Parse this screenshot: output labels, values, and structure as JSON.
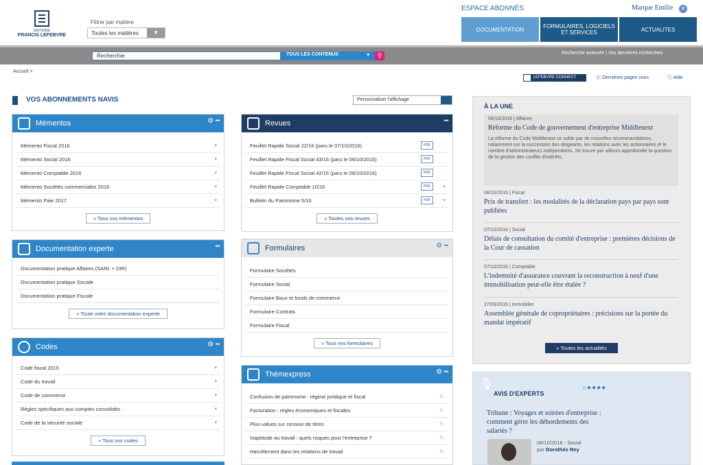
{
  "header": {
    "logo_line1": "EDITIONS",
    "logo_line2": "FRANCIS LEFEBVRE",
    "filter_label": "Filtrer par matière",
    "filter_value": "Toutes les matières",
    "espace": "ESPACE ABONNÉS",
    "user": "Marque Emilie",
    "nav": [
      "DOCUMENTATION",
      "FORMULAIRES, LOGICIELS ET SERVICES",
      "ACTUALITES"
    ]
  },
  "search": {
    "placeholder": "Rechercher",
    "scope": "TOUS LES CONTENUS",
    "links": "Recherche avancée  |  Vos dernières recherches"
  },
  "breadcrumb": "Accueil  >",
  "toolbar": {
    "connect": "LEFEBVRE CONNECT",
    "last_pages": "Dernières pages vues",
    "help": "Aide"
  },
  "main": {
    "title": "VOS ABONNEMENTS NAVIS",
    "customize": "Personnaliser l'affichage",
    "mementos": {
      "title": "Mémentos",
      "items": [
        "Mémento Fiscal 2016",
        "Mémento Social 2016",
        "Mémento Comptable 2016",
        "Mémento Sociétés commerciales 2016",
        "Mémento Paie 2017"
      ],
      "more": "» Tous vos mémentos"
    },
    "doc": {
      "title": "Documentation experte",
      "items": [
        "Documentation pratique Affaires (SARL + DIR)",
        "Documentation pratique Sociale",
        "Documentation pratique Fiscale"
      ],
      "more": "» Toute votre documentation experte"
    },
    "codes": {
      "title": "Codes",
      "items": [
        "Code fiscal 2016",
        "Code du travail",
        "Code de commerce",
        "Règles spécifiques aux comptes consolidés",
        "Code de la sécurité sociale"
      ],
      "more": "» Tous vos codes"
    },
    "revues": {
      "title": "Revues",
      "items": [
        "Feuillet Rapide Social 22/16 (paru le 07/10/2016)",
        "Feuillet Rapide Fiscal Social 43/16 (paru le 06/10/2016)",
        "Feuillet Rapide Fiscal Social 42/16 (paru le 06/10/2016)",
        "Feuillet Rapide Comptable 10/16",
        "Bulletin du Patrimoine 5/16"
      ],
      "more": "» Toutes vos revues"
    },
    "formulaires": {
      "title": "Formulaires",
      "items": [
        "Formulaire Sociétés",
        "Formulaire Social",
        "Formulaire Baux et fonds de commerce",
        "Formulaire Contrats",
        "Formulaire Fiscal"
      ],
      "more": "» Tous vos formulaires"
    },
    "themexpress": {
      "title": "Thèmexpress",
      "items": [
        "Confusion de patrimoine : régime juridique et fiscal",
        "Facturation : règles économiques et fiscales",
        "Plus-values sur cession de titres",
        "Inaptitude au travail : quels risques pour l'entreprise ?",
        "Harcèlement dans les relations de travail"
      ]
    }
  },
  "news": {
    "title": "À LA UNE",
    "items": [
      {
        "date": "06/10/2016 | Affaires",
        "title": "Réforme du Code de gouvernement d'entreprise Middlenext",
        "desc": "La réforme du Code Middlenext se solde par de nouvelles recommandations, notamment sur la succession des dirigeants, les relations avec les actionnaires et le nombre d'administrateurs indépendants. Se trouve par ailleurs approfondie la question de la gestion des conflits d'intérêts."
      },
      {
        "date": "06/10/2016 | Fiscal",
        "title": "Prix de transfert : les modalités de la déclaration pays par pays sont publiées"
      },
      {
        "date": "07/10/2016 | Social",
        "title": "Délais de consultation du comité d'entreprise : premières décisions de la Cour de cassation"
      },
      {
        "date": "07/10/2016 | Comptable",
        "title": "L'indemnité d'assurance couvrant la reconstruction à neuf d'une immobilisation peut-elle être étalée ?"
      },
      {
        "date": "27/09/2016 | Immobilier",
        "title": "Assemblée générale de copropriétaires : précisions sur la portée du mandat impératif"
      }
    ],
    "all": "» Toutes les actualités"
  },
  "avis": {
    "title": "AVIS D'EXPERTS",
    "text": "Tribune : Voyages et soirées d'entreprise : comment gérer les débordements des salariés ?",
    "date": "06/10/2016 - Social",
    "by_prefix": "par",
    "author": "Dorothée Rey"
  }
}
